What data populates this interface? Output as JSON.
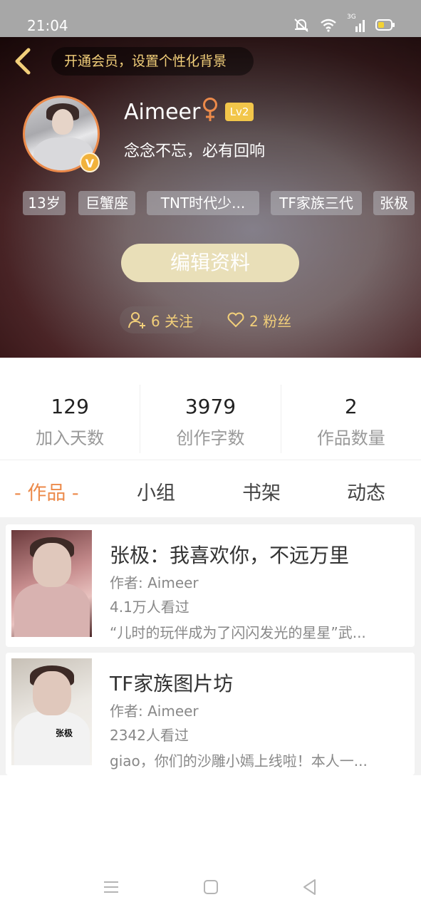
{
  "status_bar": {
    "time": "21:04",
    "network": "3G"
  },
  "header": {
    "vip_banner": "开通会员，设置个性化背景",
    "username": "Aimeer",
    "level": "Lv2",
    "motto": "念念不忘，必有回响",
    "verified_badge": "V",
    "tags": [
      "13岁",
      "巨蟹座",
      "TNT时代少...",
      "TF家族三代",
      "张极"
    ],
    "edit_button": "编辑资料",
    "follow_label": "6 关注",
    "fans_label": "2 粉丝"
  },
  "stats": [
    {
      "value": "129",
      "label": "加入天数"
    },
    {
      "value": "3979",
      "label": "创作字数"
    },
    {
      "value": "2",
      "label": "作品数量"
    }
  ],
  "tabs": [
    {
      "label": "- 作品 -",
      "active": true
    },
    {
      "label": "小组",
      "active": false
    },
    {
      "label": "书架",
      "active": false
    },
    {
      "label": "动态",
      "active": false
    }
  ],
  "works": [
    {
      "title": "张极：我喜欢你，不远万里",
      "author": "作者: Aimeer",
      "views": "4.1万人看过",
      "description": "“儿时的玩伴成为了闪闪发光的星星”武..."
    },
    {
      "title": "TF家族图片坊",
      "author": "作者: Aimeer",
      "views": "2342人看过",
      "description": "giao，你们的沙雕小嫣上线啦！本人一..."
    }
  ],
  "cover_text": "张极",
  "colors": {
    "accent": "#ec8a4a",
    "gold": "#f2cf7a",
    "edit_button": "#e9dfb8"
  }
}
